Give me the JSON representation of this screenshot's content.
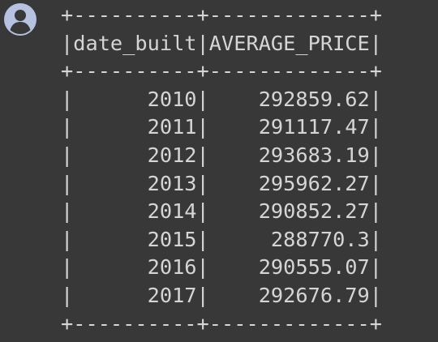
{
  "cell_output": {
    "table": {
      "columns": [
        "date_built",
        "AVERAGE_PRICE"
      ],
      "rows": [
        [
          "2010",
          "292859.62"
        ],
        [
          "2011",
          "291117.47"
        ],
        [
          "2012",
          "293683.19"
        ],
        [
          "2013",
          "295962.27"
        ],
        [
          "2014",
          "290852.27"
        ],
        [
          "2015",
          "288770.3"
        ],
        [
          "2016",
          "290555.07"
        ],
        [
          "2017",
          "292676.79"
        ]
      ]
    },
    "text_color": "#d5d5d5",
    "background_color": "#383838"
  },
  "avatar": {
    "icon": "user-avatar-icon",
    "color": "#b7c2e0"
  }
}
